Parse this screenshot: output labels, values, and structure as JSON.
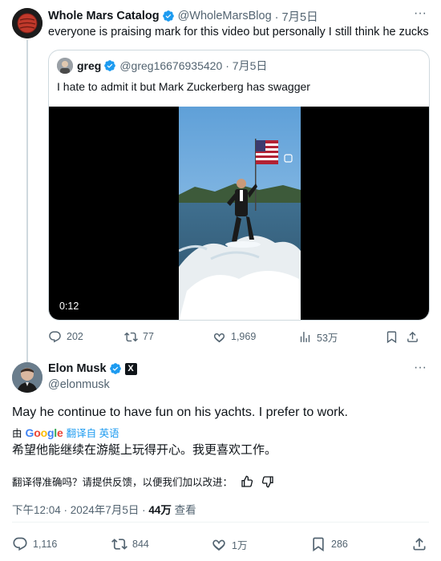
{
  "tweet1": {
    "display_name": "Whole Mars Catalog",
    "handle": "@WholeMarsBlog",
    "date": "· 7月5日",
    "text": "everyone is praising mark for this video but personally I still think he zucks",
    "quote": {
      "display_name": "greg",
      "handle": "@greg16676935420",
      "date": "· 7月5日",
      "text": "I hate to admit it but Mark Zuckerberg has swagger",
      "video_time": "0:12"
    },
    "actions": {
      "replies": "202",
      "reposts": "77",
      "likes": "1,969",
      "views": "53万"
    }
  },
  "tweet2": {
    "display_name": "Elon Musk",
    "handle": "@elonmusk",
    "text": "May he continue to have fun on his yachts. I prefer to work.",
    "translated_by_prefix": "由",
    "translated_link": "翻译自 英语",
    "translation": "希望他能继续在游艇上玩得开心。我更喜欢工作。",
    "feedback_prompt": "翻译得准确吗？请提供反馈，以便我们加以改进：",
    "timestamp": "下午12:04 · 2024年7月5日 · ",
    "views_count": "44万",
    "views_label": " 查看",
    "actions": {
      "replies": "1,116",
      "reposts": "844",
      "likes": "1万",
      "bookmarks": "286"
    }
  },
  "colors": {
    "verified": "#1d9bf0",
    "text": "#0f1419",
    "secondary": "#536471",
    "border": "#cfd9de",
    "link": "#1d9bf0"
  }
}
